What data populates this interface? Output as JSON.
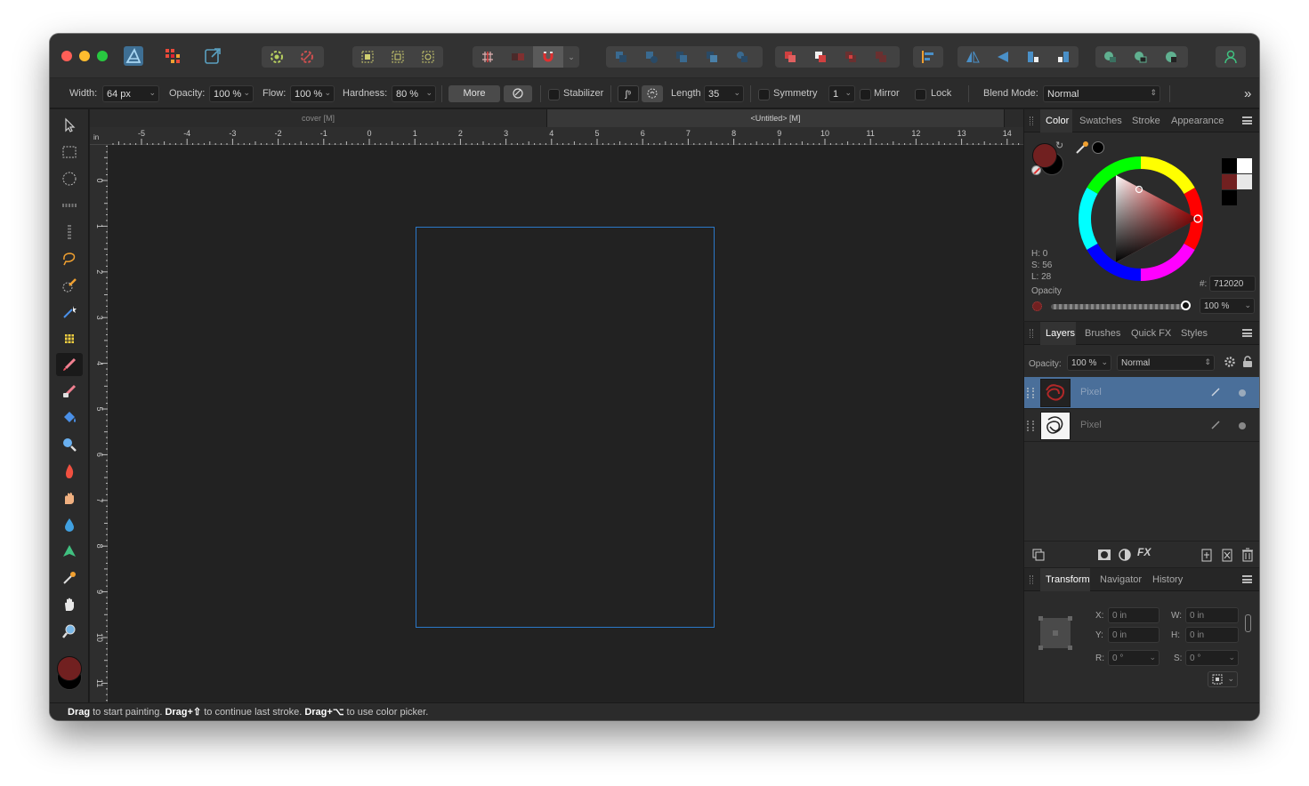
{
  "app": {
    "name": "Affinity Photo"
  },
  "context_bar": {
    "width_label": "Width:",
    "width_value": "64 px",
    "opacity_label": "Opacity:",
    "opacity_value": "100 %",
    "flow_label": "Flow:",
    "flow_value": "100 %",
    "hardness_label": "Hardness:",
    "hardness_value": "80 %",
    "more_label": "More",
    "stabilizer_label": "Stabilizer",
    "length_label": "Length",
    "length_value": "35",
    "symmetry_label": "Symmetry",
    "symmetry_value": "1",
    "mirror_label": "Mirror",
    "lock_label": "Lock",
    "blend_mode_label": "Blend Mode:",
    "blend_mode_value": "Normal",
    "overflow_label": "»"
  },
  "document_tabs": [
    {
      "label": "cover [M]",
      "active": false
    },
    {
      "label": "<Untitled> [M]",
      "active": true
    }
  ],
  "ruler": {
    "unit": "in",
    "h_labels": [
      "-5",
      "-4",
      "-3",
      "-2",
      "-1",
      "0",
      "1",
      "2",
      "3",
      "4",
      "5",
      "6",
      "7",
      "8",
      "9",
      "10",
      "11",
      "12",
      "13",
      "14"
    ],
    "v_labels": [
      "0",
      "1",
      "2",
      "3",
      "4",
      "5",
      "6",
      "7",
      "8",
      "9",
      "10",
      "11"
    ]
  },
  "tools": [
    "move-tool",
    "rectangular-marquee-tool",
    "elliptical-marquee-tool",
    "row-marquee-tool",
    "column-marquee-tool",
    "freehand-selection-tool",
    "selection-brush-tool",
    "flood-select-tool",
    "pixel-tool",
    "paint-brush-tool",
    "erase-brush-tool",
    "flood-fill-tool",
    "clone-brush-tool",
    "burn-brush-tool",
    "smudge-brush-tool",
    "blur-brush-tool",
    "sharpen-brush-tool",
    "color-picker-tool",
    "view-tool",
    "zoom-tool"
  ],
  "color_panel": {
    "tabs": [
      "Color",
      "Swatches",
      "Stroke",
      "Appearance"
    ],
    "active_tab": "Color",
    "h_label": "H: 0",
    "s_label": "S: 56",
    "l_label": "L: 28",
    "hex_label": "#:",
    "hex_value": "712020",
    "opacity_label": "Opacity",
    "opacity_value": "100 %",
    "primary_color": "#712020",
    "secondary_color": "#000000"
  },
  "layers_panel": {
    "tabs": [
      "Layers",
      "Brushes",
      "Quick FX",
      "Styles"
    ],
    "active_tab": "Layers",
    "opacity_label": "Opacity:",
    "opacity_value": "100 %",
    "blend_value": "Normal",
    "layers": [
      {
        "name": "Pixel",
        "selected": true
      },
      {
        "name": "Pixel",
        "selected": false
      }
    ],
    "selection_color": "#4a6f9a"
  },
  "transform_panel": {
    "tabs": [
      "Transform",
      "Navigator",
      "History"
    ],
    "active_tab": "Transform",
    "x_label": "X:",
    "x_value": "0 in",
    "y_label": "Y:",
    "y_value": "0 in",
    "w_label": "W:",
    "w_value": "0 in",
    "h_label": "H:",
    "h_value": "0 in",
    "r_label": "R:",
    "r_value": "0 °",
    "s_label": "S:",
    "s_value": "0 °"
  },
  "status": {
    "a": "Drag",
    "b": " to start painting. ",
    "c": "Drag+⇧",
    "d": " to continue last stroke. ",
    "e": "Drag+⌥",
    "f": " to use color picker."
  },
  "colors": {
    "accent": "#2b78c8",
    "window_bg": "#1e1e1e",
    "canvas_bg": "#222222"
  }
}
